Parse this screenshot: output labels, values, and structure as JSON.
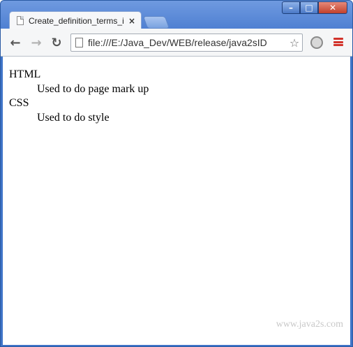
{
  "browser": {
    "tab_title": "Create_definition_terms_i",
    "address": "file:///E:/Java_Dev/WEB/release/java2sID",
    "icons": {
      "back": "back-arrow-icon",
      "forward": "forward-arrow-icon",
      "reload": "reload-icon",
      "star": "bookmark-star-icon",
      "extension": "extension-icon",
      "menu": "hamburger-menu-icon"
    },
    "menu_color": "#d2332b",
    "frame_color": "#4f80d2"
  },
  "page": {
    "definitions": [
      {
        "term": "HTML",
        "description": "Used to do page mark up"
      },
      {
        "term": "CSS",
        "description": "Used to do style"
      }
    ],
    "watermark": "www.java2s.com"
  }
}
